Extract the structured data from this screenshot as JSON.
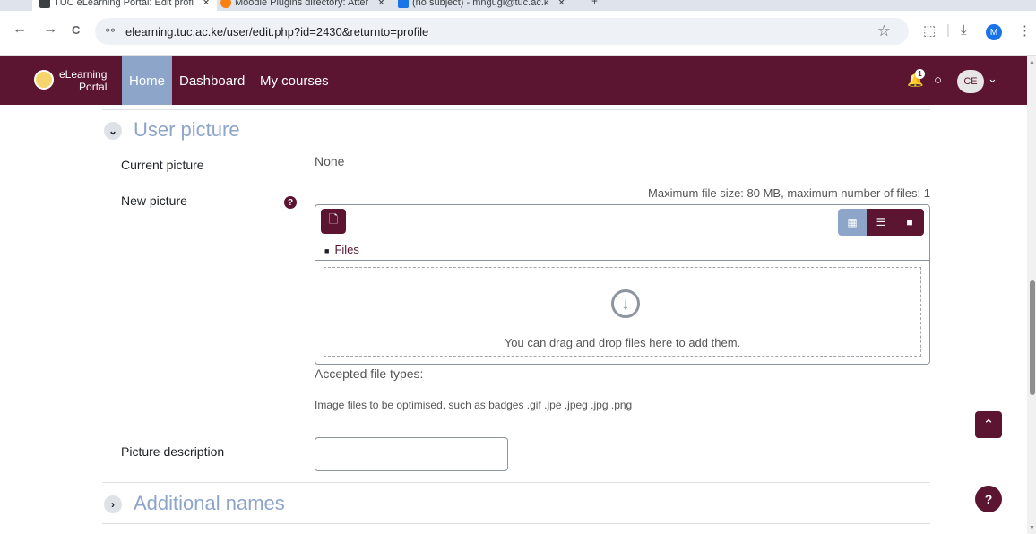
{
  "browser": {
    "tabs": [
      {
        "label": "TUC eLearning Portal: Edit profi",
        "close": "✕",
        "icon_color": "#3c4043"
      },
      {
        "label": "Moodle Plugins directory: Atter",
        "close": "✕",
        "icon_color": "#f98012"
      },
      {
        "label": "(no subject) - mngugi@tuc.ac.k",
        "close": "✕",
        "icon_color": "#1a73e8"
      }
    ],
    "new_tab": "+",
    "url": "elearning.tuc.ac.ke/user/edit.php?id=2430&returnto=profile",
    "back": "←",
    "forward": "→",
    "reload": "C",
    "site_info_icon": "⚯",
    "star_icon": "☆",
    "extensions_icon": "⬚",
    "separator": "|",
    "download_icon": "⤓",
    "menu_icon": "⋮",
    "profile_initial": "M"
  },
  "navbar": {
    "logo_line1": "eLearning",
    "logo_line2": "Portal",
    "items": [
      {
        "label": "Home",
        "active": true
      },
      {
        "label": "Dashboard",
        "active": false
      },
      {
        "label": "My courses",
        "active": false
      }
    ],
    "notification_count": "1",
    "bell_icon": "🔔",
    "message_icon": "○",
    "avatar_initials": "CE",
    "avatar_chevron": "⌄"
  },
  "section_user_picture": {
    "toggle_icon": "⌄",
    "title": "User picture",
    "current_picture_label": "Current picture",
    "current_picture_value": "None",
    "new_picture_label": "New picture",
    "help_icon": "?",
    "max_size_text": "Maximum file size: 80 MB, maximum number of files: 1",
    "filepicker": {
      "add_icon": "🗋",
      "view_icons": [
        "▦",
        "☰",
        "■"
      ],
      "files_label": "Files",
      "folder_icon": "■",
      "drop_icon": "↓",
      "drop_text": "You can drag and drop files here to add them."
    },
    "accepted_label": "Accepted file types:",
    "accepted_value": "Image files to be optimised, such as badges .gif .jpe .jpeg .jpg .png",
    "picture_description_label": "Picture description",
    "picture_description_value": ""
  },
  "section_additional_names": {
    "toggle_icon": "›",
    "title": "Additional names"
  },
  "floating": {
    "back_to_top_icon": "⌃",
    "help_icon": "?"
  },
  "scrollbar": {
    "up_icon": "▲",
    "down_icon": "▼"
  },
  "colors": {
    "brand": "#5b1530",
    "accent": "#8ca5c9"
  }
}
